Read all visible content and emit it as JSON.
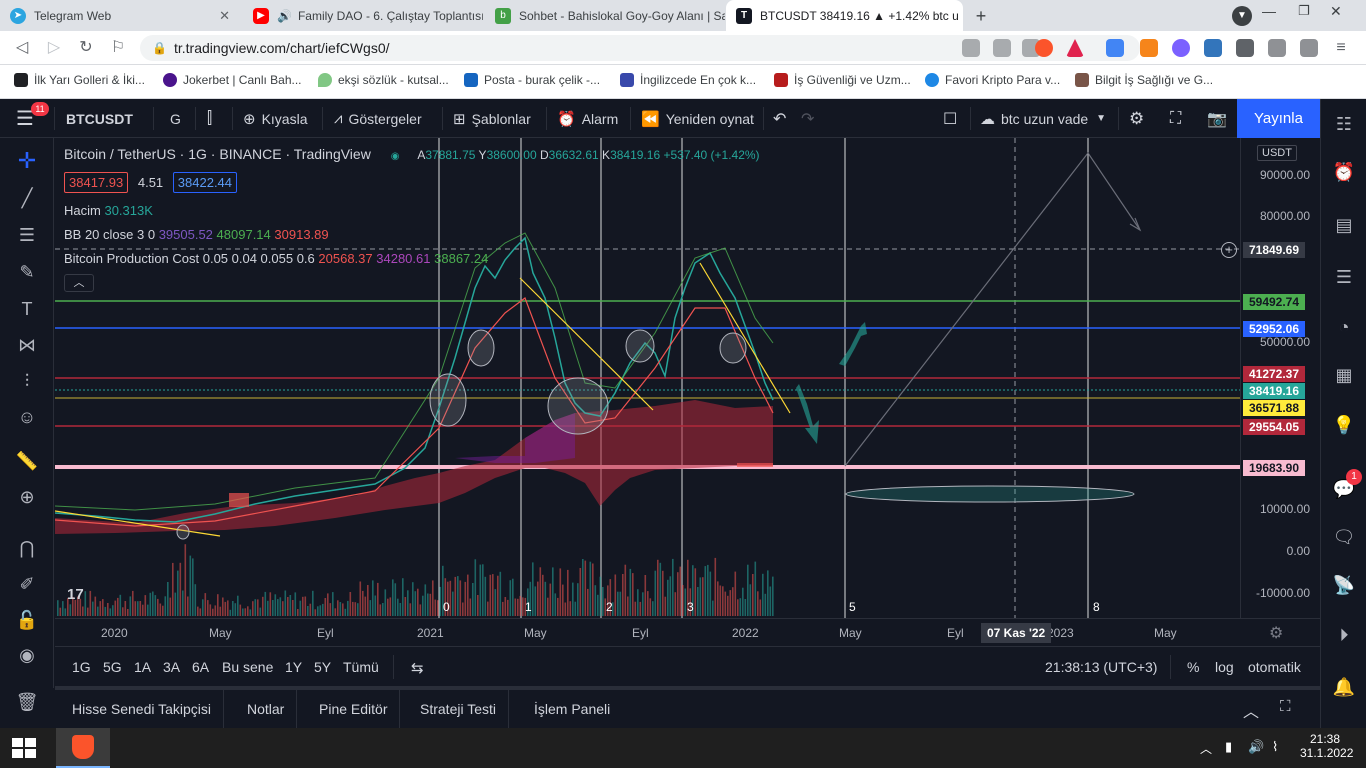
{
  "browser": {
    "tabs": [
      {
        "title": "Telegram Web",
        "active": false
      },
      {
        "title": "Family DAO - 6. Çalıştay Toplantısı",
        "active": false
      },
      {
        "title": "Sohbet - Bahislokal Goy-Goy Alanı | Sa",
        "active": false
      },
      {
        "title": "BTCUSDT 38419.16 ▲ +1.42% btc u",
        "active": true
      }
    ],
    "new_tab": "+",
    "url": "tr.tradingview.com/chart/iefCWgs0/",
    "bookmarks": [
      "İlk Yarı Golleri & İki...",
      "Jokerbet | Canlı Bah...",
      "ekşi sözlük - kutsal...",
      "Posta - burak çelik -...",
      "İngilizcede En çok k...",
      "İş Güvenliği ve Uzm...",
      "Favori Kripto Para v...",
      "Bilgit İş Sağlığı ve G..."
    ]
  },
  "toolbar": {
    "menu_badge": "11",
    "symbol": "BTCUSDT",
    "interval": "G",
    "compare": "Kıyasla",
    "indicators": "Göstergeler",
    "templates": "Şablonlar",
    "alert": "Alarm",
    "replay": "Yeniden oynat",
    "layout_name": "btc uzun vade",
    "publish": "Yayınla"
  },
  "legend": {
    "title": "Bitcoin / TetherUS · 1G · BINANCE · TradingView",
    "ohlc": {
      "open_label": "A",
      "open": "37881.75",
      "high_label": "Y",
      "high": "38600.00",
      "low_label": "D",
      "low": "36632.61",
      "close_label": "K",
      "close": "38419.16",
      "change": "+537.40 (+1.42%)"
    },
    "bid": "38417.93",
    "spread": "4.51",
    "ask": "38422.44",
    "volume_label": "Hacim",
    "volume": "30.313K",
    "bb_label": "BB 20 close 3 0",
    "bb_values": [
      "39505.52",
      "48097.14",
      "30913.89"
    ],
    "pc_label": "Bitcoin Production Cost 0.05 0.04 0.055 0.6",
    "pc_values": [
      "20568.37",
      "34280.61",
      "38867.24"
    ]
  },
  "price_scale": {
    "currency": "USDT",
    "ticks": [
      "90000.00",
      "80000.00",
      "50000.00",
      "10000.00",
      "0.00",
      "-10000.00"
    ],
    "labels": [
      {
        "value": "71849.69",
        "color": "#363a45"
      },
      {
        "value": "59492.74",
        "color": "#4caf50"
      },
      {
        "value": "52952.06",
        "color": "#2962ff"
      },
      {
        "value": "41272.37",
        "color": "#b2283b"
      },
      {
        "value": "38419.16",
        "color": "#26a69a"
      },
      {
        "value": "36571.88",
        "color": "#ffeb3b"
      },
      {
        "value": "29554.05",
        "color": "#b2283b"
      },
      {
        "value": "19683.90",
        "color": "#f8bbd0"
      }
    ]
  },
  "chart_annotations": {
    "cycle_marks": [
      "0",
      "1",
      "2",
      "3",
      "5",
      "8"
    ]
  },
  "time_scale": {
    "labels": [
      "2020",
      "May",
      "Eyl",
      "2021",
      "May",
      "Eyl",
      "2022",
      "May",
      "Eyl",
      "2023",
      "May"
    ],
    "cursor_date": "07 Kas '22"
  },
  "range_bar": {
    "ranges": [
      "1G",
      "5G",
      "1A",
      "3A",
      "6A",
      "Bu sene",
      "1Y",
      "5Y",
      "Tümü"
    ],
    "time": "21:38:13 (UTC+3)",
    "percent": "%",
    "log": "log",
    "auto": "otomatik"
  },
  "bottom_panel": {
    "tabs": [
      "Hisse Senedi Takipçisi",
      "Notlar",
      "Pine Editör",
      "Strateji Testi",
      "İşlem Paneli"
    ]
  },
  "right_sidebar": {
    "notif_badge": "1"
  },
  "taskbar": {
    "time": "21:38",
    "date": "31.1.2022"
  },
  "colors": {
    "bg": "#131722",
    "accent": "#2962ff",
    "up": "#26a69a",
    "down": "#ef5350"
  }
}
